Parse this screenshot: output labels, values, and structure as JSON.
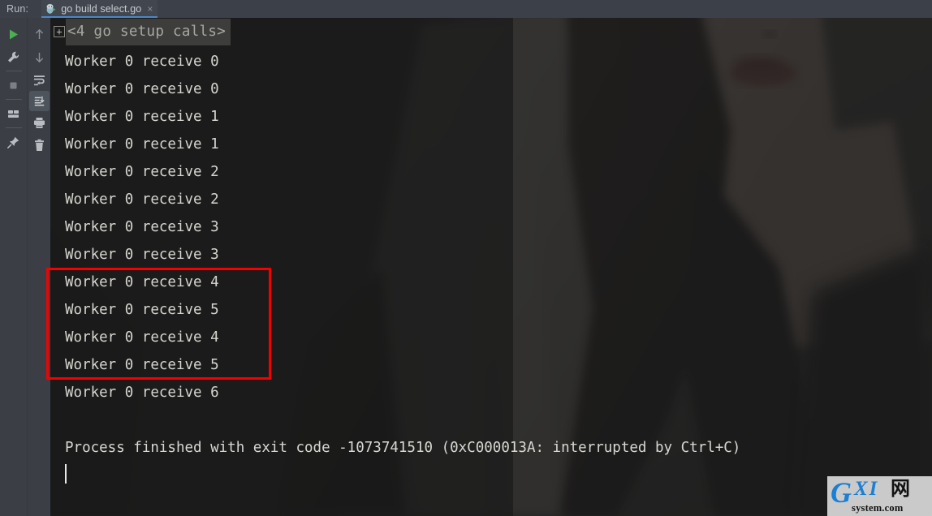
{
  "window": {
    "run_label": "Run:",
    "tab": {
      "icon": "go-gopher-icon",
      "label": "go build select.go",
      "close": "×"
    }
  },
  "toolbar_left": {
    "items": [
      {
        "name": "rerun-button",
        "icon": "play-icon"
      },
      {
        "name": "edit-configuration-button",
        "icon": "wrench-icon"
      },
      {
        "name": "stop-button",
        "icon": "stop-square-icon"
      },
      {
        "name": "layout-settings-button",
        "icon": "layout-icon"
      },
      {
        "name": "pin-tab-button",
        "icon": "pin-icon"
      }
    ]
  },
  "toolbar_secondary": {
    "items": [
      {
        "name": "up-stack-trace-button",
        "icon": "arrow-up-icon"
      },
      {
        "name": "down-stack-trace-button",
        "icon": "arrow-down-icon"
      },
      {
        "name": "soft-wrap-button",
        "icon": "soft-wrap-icon"
      },
      {
        "name": "scroll-to-end-button",
        "icon": "scroll-to-end-icon",
        "selected": true
      },
      {
        "name": "print-button",
        "icon": "printer-icon"
      },
      {
        "name": "clear-all-button",
        "icon": "trash-icon"
      }
    ]
  },
  "console": {
    "fold": {
      "expand_glyph": "+",
      "text": "<4 go setup calls>"
    },
    "lines": [
      {
        "text": "Worker 0 receive 0",
        "highlighted": false
      },
      {
        "text": "Worker 0 receive 0",
        "highlighted": false
      },
      {
        "text": "Worker 0 receive 1",
        "highlighted": false
      },
      {
        "text": "Worker 0 receive 1",
        "highlighted": false
      },
      {
        "text": "Worker 0 receive 2",
        "highlighted": false
      },
      {
        "text": "Worker 0 receive 2",
        "highlighted": false
      },
      {
        "text": "Worker 0 receive 3",
        "highlighted": false
      },
      {
        "text": "Worker 0 receive 3",
        "highlighted": false
      },
      {
        "text": "Worker 0 receive 4",
        "highlighted": true
      },
      {
        "text": "Worker 0 receive 5",
        "highlighted": true
      },
      {
        "text": "Worker 0 receive 4",
        "highlighted": true
      },
      {
        "text": "Worker 0 receive 5",
        "highlighted": true
      },
      {
        "text": "Worker 0 receive 6",
        "highlighted": false
      }
    ],
    "process_finished": "Process finished with exit code -1073741510 (0xC000013A: interrupted by Ctrl+C)"
  },
  "annotation": {
    "color": "#f50000",
    "covers_lines": [
      "Worker 0 receive 4",
      "Worker 0 receive 5",
      "Worker 0 receive 4",
      "Worker 0 receive 5"
    ]
  },
  "watermark": {
    "g": "G",
    "xi": "XI",
    "cn": "网",
    "site": "system.com"
  },
  "colors": {
    "runbar_bg": "#3c4149",
    "tab_underline": "#4a88c7",
    "toolbar_bg": "#3b3f45",
    "console_text": "#d6d6d0",
    "fold_text": "#a8a8a2",
    "annotation_red": "#f50000",
    "watermark_blue": "#1b7fd4"
  }
}
